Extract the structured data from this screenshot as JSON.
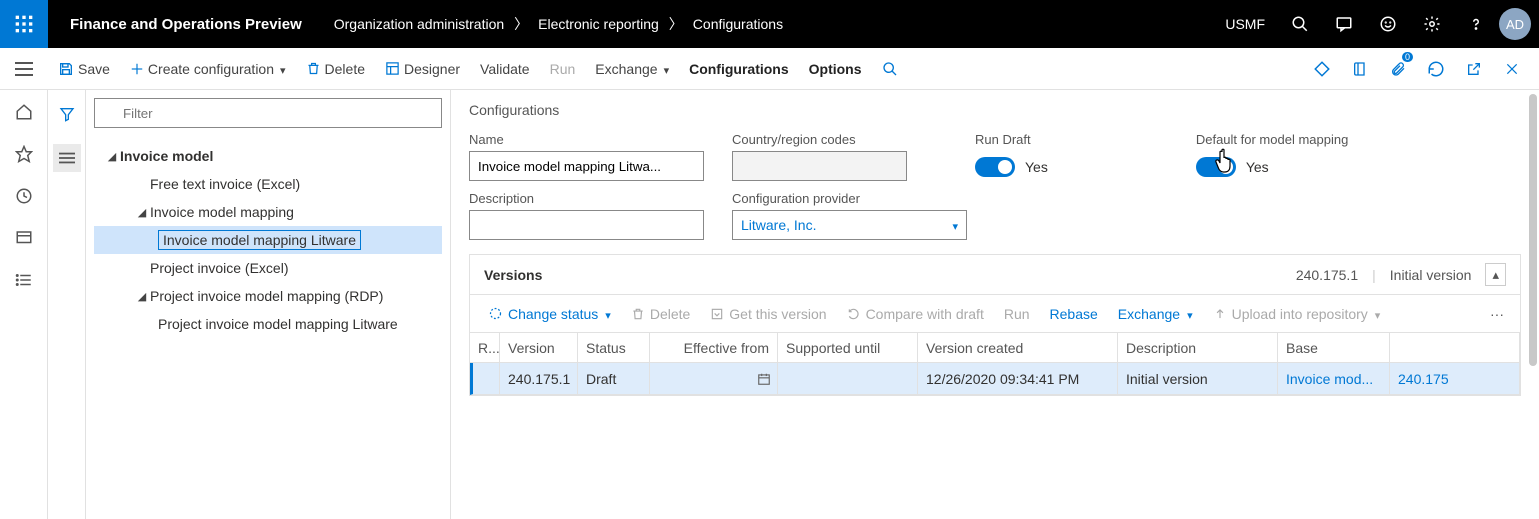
{
  "header": {
    "app_title": "Finance and Operations Preview",
    "crumbs": [
      "Organization administration",
      "Electronic reporting",
      "Configurations"
    ],
    "legal_entity": "USMF",
    "avatar": "AD"
  },
  "actionpane": {
    "save": "Save",
    "create": "Create configuration",
    "delete": "Delete",
    "designer": "Designer",
    "validate": "Validate",
    "run": "Run",
    "exchange": "Exchange",
    "configurations": "Configurations",
    "options": "Options"
  },
  "tree": {
    "filter_placeholder": "Filter",
    "nodes": {
      "n0": "Invoice model",
      "n1": "Free text invoice (Excel)",
      "n2": "Invoice model mapping",
      "n3": "Invoice model mapping Litware",
      "n4": "Project invoice (Excel)",
      "n5": "Project invoice model mapping (RDP)",
      "n6": "Project invoice model mapping Litware"
    }
  },
  "form": {
    "section": "Configurations",
    "labels": {
      "name": "Name",
      "country": "Country/region codes",
      "run_draft": "Run Draft",
      "default_mm": "Default for model mapping",
      "description": "Description",
      "provider": "Configuration provider"
    },
    "values": {
      "name": "Invoice model mapping Litwa...",
      "country": "",
      "description": "",
      "provider": "Litware, Inc.",
      "run_draft_text": "Yes",
      "default_mm_text": "Yes"
    }
  },
  "versions": {
    "title": "Versions",
    "summary_ver": "240.175.1",
    "summary_desc": "Initial version",
    "toolbar": {
      "change_status": "Change status",
      "delete": "Delete",
      "get": "Get this version",
      "compare": "Compare with draft",
      "run": "Run",
      "rebase": "Rebase",
      "exchange": "Exchange",
      "upload": "Upload into repository"
    },
    "columns": {
      "r": "R...",
      "version": "Version",
      "status": "Status",
      "effective": "Effective from",
      "supported": "Supported until",
      "created": "Version created",
      "description": "Description",
      "base": "Base",
      "basever": ""
    },
    "rows": [
      {
        "version": "240.175.1",
        "status": "Draft",
        "effective": "",
        "supported": "",
        "created": "12/26/2020 09:34:41 PM",
        "description": "Initial version",
        "base": "Invoice mod...",
        "basever": "240.175"
      }
    ]
  }
}
